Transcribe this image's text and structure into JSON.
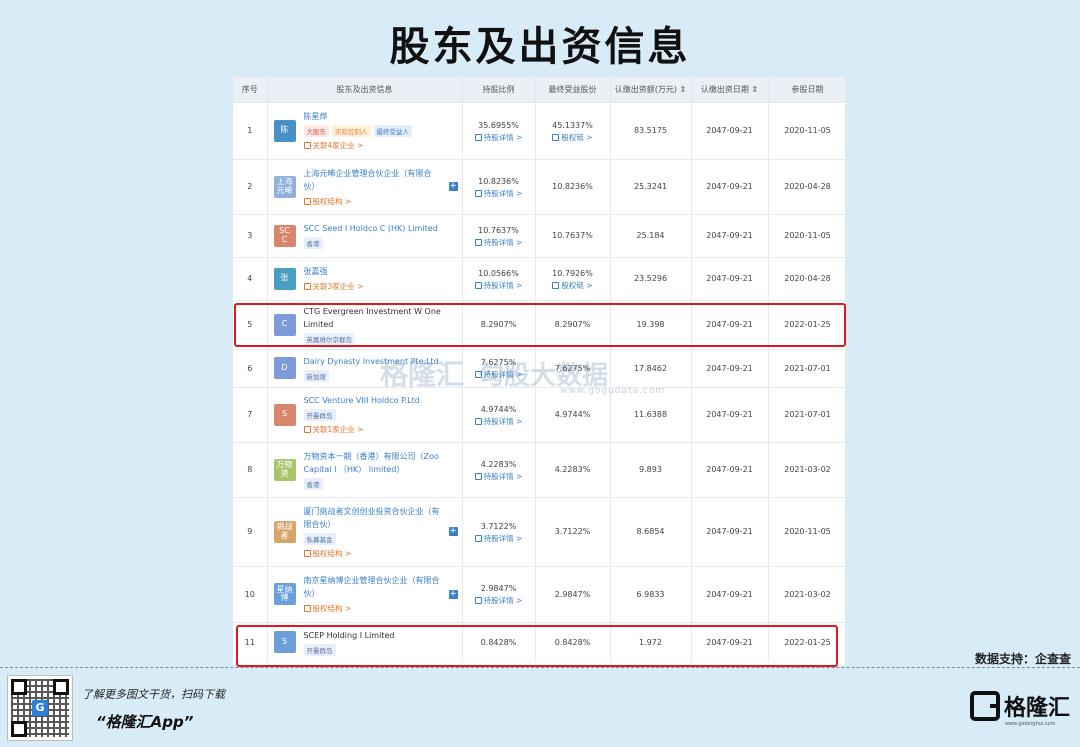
{
  "title": "股东及出资信息",
  "headers": [
    "序号",
    "股东及出资信息",
    "持股比例",
    "最终受益股份",
    "认缴出资额(万元)",
    "认缴出资日期",
    "参股日期"
  ],
  "sort_mark": "⇕",
  "rows": [
    {
      "idx": "1",
      "logo": "陈",
      "logo_color": "#4a8fc8",
      "name": "陈星烨",
      "name_link": true,
      "tags": [
        {
          "t": "大股东",
          "c": "red"
        },
        {
          "t": "实际控制人",
          "c": "orange"
        },
        {
          "t": "最终受益人",
          "c": "blue"
        }
      ],
      "link": "关联4家企业 >",
      "pct": "35.6955%",
      "pct_link": "持股详情 >",
      "benefit": "45.1337%",
      "benefit_link": "股权链 >",
      "capital": "83.5175",
      "cap_date": "2047-09-21",
      "join_date": "2020-11-05"
    },
    {
      "idx": "2",
      "logo": "上海\n元晞",
      "logo_color": "#8fb0d8",
      "name": "上海元晞企业管理合伙企业（有限合伙）",
      "name_link": true,
      "plus": true,
      "tags": [],
      "link": "股权结构 >",
      "pct": "10.8236%",
      "pct_link": "持股详情 >",
      "benefit": "10.8236%",
      "capital": "25.3241",
      "cap_date": "2047-09-21",
      "join_date": "2020-04-28"
    },
    {
      "idx": "3",
      "logo": "SC\nC",
      "logo_color": "#d8876a",
      "name": "SCC Seed I Holdco C (HK) Limited",
      "name_link": true,
      "tags": [
        {
          "t": "香港",
          "c": ""
        }
      ],
      "pct": "10.7637%",
      "pct_link": "持股详情 >",
      "benefit": "10.7637%",
      "capital": "25.184",
      "cap_date": "2047-09-21",
      "join_date": "2020-11-05"
    },
    {
      "idx": "4",
      "logo": "张",
      "logo_color": "#4a9fc0",
      "name": "张嘉强",
      "name_link": true,
      "tags": [],
      "link": "关联3家企业 >",
      "pct": "10.0566%",
      "pct_link": "持股详情 >",
      "benefit": "10.7926%",
      "benefit_link": "股权链 >",
      "capital": "23.5296",
      "cap_date": "2047-09-21",
      "join_date": "2020-04-28"
    },
    {
      "idx": "5",
      "logo": "C",
      "logo_color": "#7d9bd8",
      "name": "CTG Evergreen Investment W One Limited",
      "name_link": false,
      "tags": [
        {
          "t": "英属维尔京群岛",
          "c": ""
        }
      ],
      "pct": "8.2907%",
      "benefit": "8.2907%",
      "capital": "19.398",
      "cap_date": "2047-09-21",
      "join_date": "2022-01-25",
      "highlight": true
    },
    {
      "idx": "6",
      "logo": "D",
      "logo_color": "#7d9bd8",
      "name": "Dairy Dynasty Investment Pte.Ltd",
      "name_link": true,
      "tags": [
        {
          "t": "新加坡",
          "c": ""
        }
      ],
      "pct": "7.6275%",
      "pct_link": "持股详情 >",
      "benefit": "7.6275%",
      "capital": "17.8462",
      "cap_date": "2047-09-21",
      "join_date": "2021-07-01"
    },
    {
      "idx": "7",
      "logo": "S",
      "logo_color": "#d8876a",
      "name": "SCC Venture VIII Holdco P.Ltd",
      "name_link": true,
      "tags": [
        {
          "t": "开曼群岛",
          "c": ""
        }
      ],
      "link": "关联1家企业 >",
      "pct": "4.9744%",
      "pct_link": "持股详情 >",
      "benefit": "4.9744%",
      "capital": "11.6388",
      "cap_date": "2047-09-21",
      "join_date": "2021-07-01"
    },
    {
      "idx": "8",
      "logo": "万物\n资",
      "logo_color": "#a9c46a",
      "name": "万物资本一期（香港）有限公司（Zoo Capital Ⅰ （HK） limited）",
      "name_link": true,
      "tags": [
        {
          "t": "香港",
          "c": ""
        }
      ],
      "pct": "4.2283%",
      "pct_link": "持股详情 >",
      "benefit": "4.2283%",
      "capital": "9.893",
      "cap_date": "2047-09-21",
      "join_date": "2021-03-02"
    },
    {
      "idx": "9",
      "logo": "挑战\n者",
      "logo_color": "#d8a56a",
      "name": "厦门挑战者文创创业投资合伙企业（有限合伙）",
      "name_link": true,
      "plus": true,
      "tags": [
        {
          "t": "私募基金",
          "c": ""
        }
      ],
      "link": "股权结构 >",
      "pct": "3.7122%",
      "pct_link": "持股详情 >",
      "benefit": "3.7122%",
      "capital": "8.6854",
      "cap_date": "2047-09-21",
      "join_date": "2020-11-05"
    },
    {
      "idx": "10",
      "logo": "星纳\n博",
      "logo_color": "#6a9fd8",
      "name": "南京星纳博企业管理合伙企业（有限合伙）",
      "name_link": true,
      "plus": true,
      "tags": [],
      "link": "股权结构 >",
      "pct": "2.9847%",
      "pct_link": "持股详情 >",
      "benefit": "2.9847%",
      "capital": "6.9833",
      "cap_date": "2047-09-21",
      "join_date": "2021-03-02"
    },
    {
      "idx": "11",
      "logo": "S",
      "logo_color": "#6a9fd8",
      "name": "SCEP Holding I Limited",
      "name_link": false,
      "tags": [
        {
          "t": "开曼群岛",
          "c": ""
        }
      ],
      "pct": "0.8428%",
      "benefit": "0.8428%",
      "capital": "1.972",
      "cap_date": "2047-09-21",
      "join_date": "2022-01-25",
      "highlight": true
    }
  ],
  "watermark": {
    "brand": "格隆汇",
    "brand2": "勾股大数据",
    "url1": "www.gelonghui.com",
    "url2": "www.gogudata.com"
  },
  "footer": {
    "support": "数据支持：企查查",
    "promo1": "了解更多图文干货，扫码下载",
    "promo2": "“格隆汇App”",
    "brand": "格隆汇",
    "brand_url": "www.gelonghui.com"
  }
}
